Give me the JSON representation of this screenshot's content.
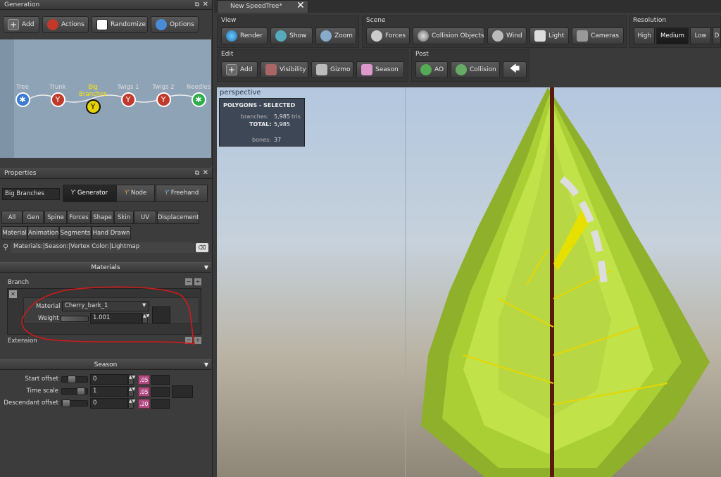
{
  "generation": {
    "title": "Generation",
    "toolbar": [
      {
        "label": "Add",
        "icon": "add-icon"
      },
      {
        "label": "Actions",
        "icon": "actions-icon"
      },
      {
        "label": "Randomize",
        "icon": "dice-icon"
      },
      {
        "label": "Options",
        "icon": "gear-icon"
      }
    ],
    "nodes": [
      {
        "label": "Tree",
        "color": "#3a7bd5",
        "selected": false
      },
      {
        "label": "Trunk",
        "color": "#c0392b",
        "selected": false
      },
      {
        "label": "Big Branches",
        "color": "#e6d200",
        "selected": true
      },
      {
        "label": "Twigs 1",
        "color": "#c0392b",
        "selected": false
      },
      {
        "label": "Twigs 2",
        "color": "#c0392b",
        "selected": false
      },
      {
        "label": "Needles",
        "color": "#2eae4a",
        "selected": false
      }
    ]
  },
  "properties": {
    "title": "Properties",
    "node_name": "Big Branches",
    "mode_tabs": [
      {
        "label": "Generator",
        "active": true
      },
      {
        "label": "Node",
        "active": false
      },
      {
        "label": "Freehand",
        "active": false
      }
    ],
    "category_tabs_row1": [
      "All",
      "Gen",
      "Spine",
      "Forces",
      "Shape",
      "Skin",
      "UV",
      "Displacement"
    ],
    "category_tabs_row2": [
      "Material",
      "Animation",
      "Segments",
      "Hand Drawn"
    ],
    "filter_text": "Materials:|Season:|Vertex Color:|Lightmap",
    "materials": {
      "header": "Materials",
      "branch_label": "Branch",
      "material_label": "Material",
      "material_value": "Cherry_bark_1",
      "weight_label": "Weight",
      "weight_value": "1.001",
      "extension_label": "Extension"
    },
    "season": {
      "header": "Season",
      "rows": [
        {
          "label": "Start offset",
          "value": "0",
          "rate": ".05",
          "level": 0.3
        },
        {
          "label": "Time scale",
          "value": "1",
          "rate": ".05",
          "level": 0.8
        },
        {
          "label": "Descendant offset",
          "value": "0",
          "rate": ".20",
          "level": 0.0
        }
      ]
    }
  },
  "document_tab": {
    "label": "New SpeedTree*"
  },
  "view_group": {
    "title": "View",
    "buttons": [
      {
        "label": "Render",
        "icon": "globe-icon"
      },
      {
        "label": "Show",
        "icon": "eye-icon"
      },
      {
        "label": "Zoom",
        "icon": "magnifier-icon"
      }
    ]
  },
  "scene_group": {
    "title": "Scene",
    "buttons": [
      {
        "label": "Forces",
        "icon": "magnet-icon"
      },
      {
        "label": "Collision Objects",
        "icon": "sphere-icon"
      },
      {
        "label": "Wind",
        "icon": "wind-icon"
      },
      {
        "label": "Light",
        "icon": "light-icon"
      },
      {
        "label": "Cameras",
        "icon": "camera-icon"
      }
    ]
  },
  "resolution_group": {
    "title": "Resolution",
    "options": [
      {
        "label": "High",
        "active": false
      },
      {
        "label": "Medium",
        "active": true
      },
      {
        "label": "Low",
        "active": false
      },
      {
        "label": "D",
        "active": false
      }
    ]
  },
  "edit_group": {
    "title": "Edit",
    "buttons": [
      {
        "label": "Add",
        "icon": "add-icon"
      },
      {
        "label": "Visibility",
        "icon": "visibility-icon"
      },
      {
        "label": "Gizmo",
        "icon": "gizmo-icon"
      },
      {
        "label": "Season",
        "icon": "calendar-icon"
      }
    ]
  },
  "post_group": {
    "title": "Post",
    "buttons": [
      {
        "label": "AO",
        "icon": "ao-icon"
      },
      {
        "label": "Collision",
        "icon": "collision-icon"
      },
      {
        "label": "",
        "icon": "arrow-left-icon"
      }
    ]
  },
  "viewport": {
    "camera_label": "perspective",
    "stats": {
      "title": "POLYGONS - SELECTED",
      "branches_label": "branches:",
      "branches_value": "5,985",
      "branches_unit": "tris",
      "total_label": "TOTAL:",
      "total_value": "5,985",
      "bones_label": "bones:",
      "bones_value": "37"
    }
  },
  "colors": {
    "selection_annotation": "#d01a1a",
    "foliage": "#b8e03a",
    "accent_pink": "#b04a80"
  }
}
